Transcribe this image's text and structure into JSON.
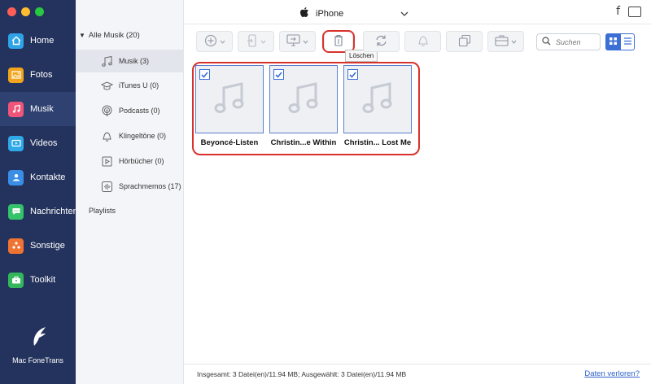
{
  "window": {
    "traffic_lights": [
      "#ff5f57",
      "#febc2e",
      "#28c840"
    ]
  },
  "sidebar": {
    "items": [
      {
        "label": "Home",
        "icon": "home-icon",
        "color": "#2fa3e8"
      },
      {
        "label": "Fotos",
        "icon": "photos-icon",
        "color": "#f2a51c"
      },
      {
        "label": "Musik",
        "icon": "music-icon",
        "color": "#f05579",
        "active": true
      },
      {
        "label": "Videos",
        "icon": "video-icon",
        "color": "#2fa8e8"
      },
      {
        "label": "Kontakte",
        "icon": "contacts-icon",
        "color": "#3a8ee6"
      },
      {
        "label": "Nachrichten",
        "icon": "messages-icon",
        "color": "#34c26a"
      },
      {
        "label": "Sonstige",
        "icon": "others-icon",
        "color": "#ef7332"
      },
      {
        "label": "Toolkit",
        "icon": "toolkit-icon",
        "color": "#34b75c"
      }
    ],
    "brand": "Mac FoneTrans"
  },
  "categories": {
    "header": "Alle Musik (20)",
    "items": [
      {
        "label": "Musik (3)",
        "icon": "music-note-icon",
        "active": true
      },
      {
        "label": "iTunes U (0)",
        "icon": "graduation-cap-icon"
      },
      {
        "label": "Podcasts (0)",
        "icon": "podcast-icon"
      },
      {
        "label": "Klingeltöne (0)",
        "icon": "bell-icon"
      },
      {
        "label": "Hörbücher (0)",
        "icon": "audiobook-icon"
      },
      {
        "label": "Sprachmemos (17)",
        "icon": "voice-memo-icon"
      }
    ],
    "playlists": "Playlists"
  },
  "titlebar": {
    "device": "iPhone",
    "icons": [
      "apple-icon",
      "chevron-down-icon",
      "facebook-icon",
      "message-icon"
    ]
  },
  "toolbar": {
    "delete_tooltip": "Löschen",
    "search_placeholder": "Suchen",
    "accent": "#3b6fd6",
    "highlight": "#d9322c"
  },
  "songs": [
    {
      "title": "Beyoncé-Listen",
      "checked": true
    },
    {
      "title": "Christin...e Within",
      "checked": true
    },
    {
      "title": "Christin... Lost Me",
      "checked": true
    }
  ],
  "status": {
    "text": "Insgesamt: 3 Datei(en)/11.94 MB; Ausgewählt: 3 Datei(en)/11.94 MB",
    "lost_link": "Daten verloren?"
  }
}
